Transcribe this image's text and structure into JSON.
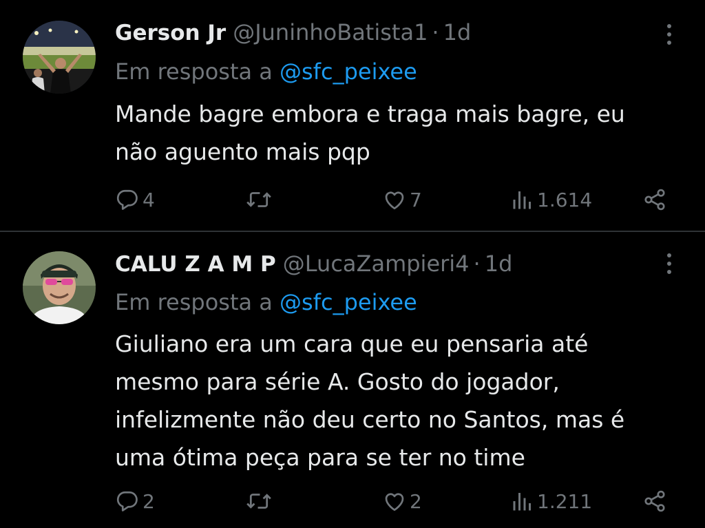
{
  "tweets": [
    {
      "display_name": "Gerson Jr",
      "handle": "@JuninhoBatista1",
      "separator": "·",
      "time": "1d",
      "reply_prefix": "Em resposta a",
      "reply_to": "@sfc_peixee",
      "text_lines": [
        "Mande bagre embora e traga mais bagre, eu",
        "não aguento mais pqp"
      ],
      "replies": "4",
      "retweets": "",
      "likes": "7",
      "views": "1.614",
      "avatar_icon": "stadium-avatar"
    },
    {
      "display_name": "CALU Z A M P",
      "handle": "@LucaZampieri4",
      "separator": "·",
      "time": "1d",
      "reply_prefix": "Em resposta a",
      "reply_to": "@sfc_peixee",
      "text_lines": [
        "Giuliano era um cara que eu pensaria até",
        "mesmo para série A. Gosto do jogador,",
        "infelizmente não deu certo no Santos, mas é",
        "uma ótima peça para se ter no time"
      ],
      "replies": "2",
      "retweets": "",
      "likes": "2",
      "views": "1.211",
      "avatar_icon": "person-avatar"
    }
  ],
  "colors": {
    "background": "#000000",
    "primary_text": "#e7e9ea",
    "secondary_text": "#71767b",
    "link": "#1d9bf0",
    "divider": "#2f3336"
  },
  "icons": {
    "reply": "reply-icon",
    "retweet": "retweet-icon",
    "like": "heart-icon",
    "views": "views-icon",
    "share": "share-icon",
    "more": "more-icon"
  }
}
